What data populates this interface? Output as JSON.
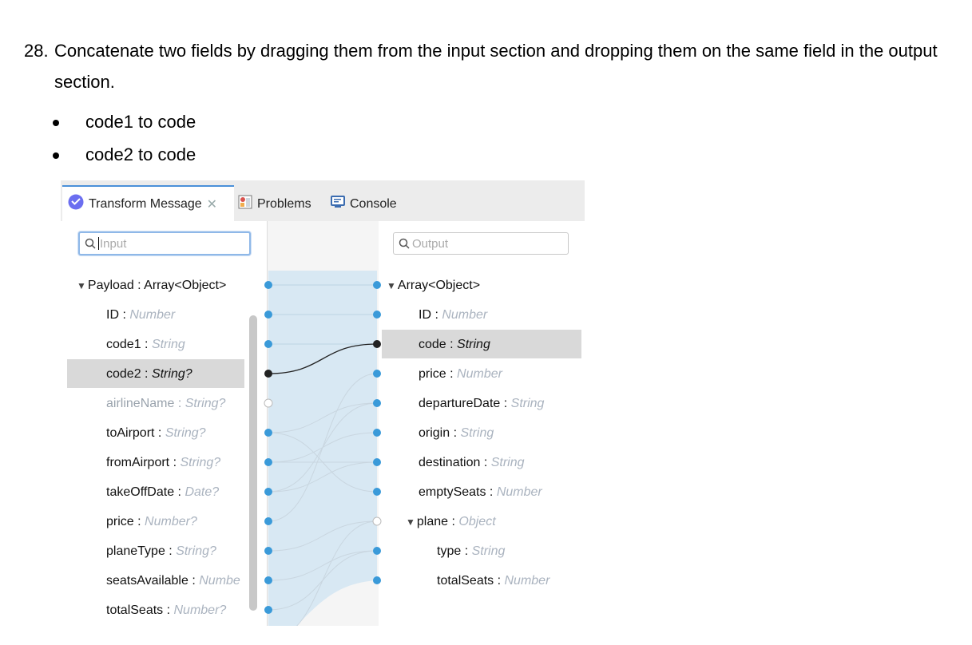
{
  "instructions": {
    "step_number": "28.",
    "step_text": "Concatenate two fields by dragging them from the input section and dropping them on the same field in the output section.",
    "bullets": [
      "code1 to code",
      "code2 to code"
    ]
  },
  "tabs": [
    {
      "label": "Transform Message",
      "icon": "dataweave-icon",
      "active": true,
      "closable": true
    },
    {
      "label": "Problems",
      "icon": "problems-icon",
      "active": false
    },
    {
      "label": "Console",
      "icon": "console-icon",
      "active": false
    }
  ],
  "input": {
    "search_placeholder": "Input",
    "root": {
      "name": "Payload",
      "type": "Array<Object>"
    },
    "fields": [
      {
        "name": "ID",
        "type": "Number"
      },
      {
        "name": "code1",
        "type": "String"
      },
      {
        "name": "code2",
        "type": "String?"
      },
      {
        "name": "airlineName",
        "type": "String?"
      },
      {
        "name": "toAirport",
        "type": "String?"
      },
      {
        "name": "fromAirport",
        "type": "String?"
      },
      {
        "name": "takeOffDate",
        "type": "Date?"
      },
      {
        "name": "price",
        "type": "Number?"
      },
      {
        "name": "planeType",
        "type": "String?"
      },
      {
        "name": "seatsAvailable",
        "type": "Numbe"
      },
      {
        "name": "totalSeats",
        "type": "Number?"
      }
    ]
  },
  "output": {
    "search_placeholder": "Output",
    "root": {
      "name": "",
      "type": "Array<Object>"
    },
    "fields": [
      {
        "name": "ID",
        "type": "Number"
      },
      {
        "name": "code",
        "type": "String"
      },
      {
        "name": "price",
        "type": "Number"
      },
      {
        "name": "departureDate",
        "type": "String"
      },
      {
        "name": "origin",
        "type": "String"
      },
      {
        "name": "destination",
        "type": "String"
      },
      {
        "name": "emptySeats",
        "type": "Number"
      },
      {
        "name": "plane",
        "type": "Object"
      },
      {
        "name": "type",
        "type": "String"
      },
      {
        "name": "totalSeats",
        "type": "Number"
      }
    ]
  },
  "colors": {
    "dot": "#3a9ad9",
    "highlight": "#d9d9d9",
    "band": "#d8e8f3",
    "active_link": "#222222",
    "accent": "#4a90d9"
  }
}
